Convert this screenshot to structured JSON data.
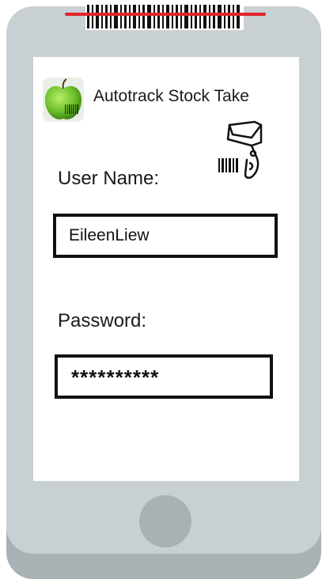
{
  "app": {
    "title": "Autotrack Stock Take"
  },
  "icons": {
    "logo": "apple-barcode-logo-icon",
    "scanner": "barcode-scanner-icon",
    "top_barcode": "barcode-icon"
  },
  "form": {
    "username_label": "User Name:",
    "username_value": "EileenLiew",
    "password_label": "Password:",
    "password_value": "**********"
  },
  "colors": {
    "phone_body": "#c9d0d4",
    "phone_shadow": "#a9b1b5",
    "scan_line": "#e0242b",
    "logo_green": "#6cbf2a"
  }
}
